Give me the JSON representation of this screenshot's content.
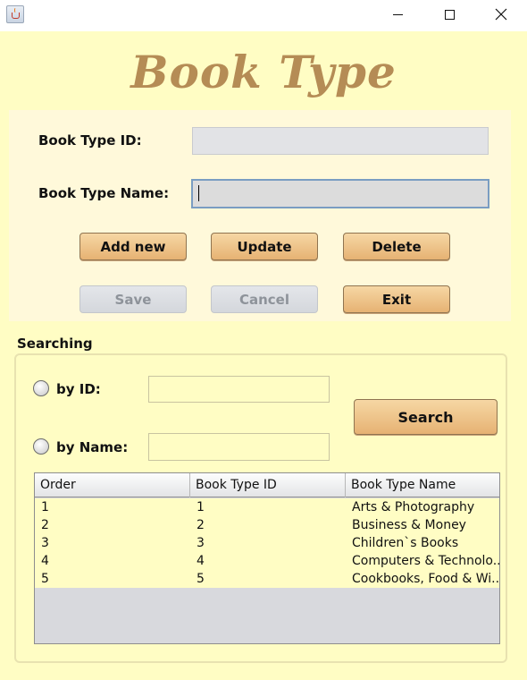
{
  "window": {
    "app_icon": "java-cup-icon"
  },
  "title": "Book Type",
  "form": {
    "id_label": "Book Type ID:",
    "id_value": "",
    "name_label": "Book Type Name:",
    "name_value": ""
  },
  "buttons": {
    "add_new": "Add new",
    "update": "Update",
    "delete": "Delete",
    "save": "Save",
    "cancel": "Cancel",
    "exit": "Exit"
  },
  "searching": {
    "label": "Searching",
    "by_id_label": "by ID:",
    "by_id_value": "",
    "by_name_label": "by Name:",
    "by_name_value": "",
    "search_button": "Search"
  },
  "table": {
    "columns": [
      "Order",
      "Book Type ID",
      "Book Type Name"
    ],
    "rows": [
      [
        "1",
        "1",
        "Arts & Photography"
      ],
      [
        "2",
        "2",
        "Business & Money"
      ],
      [
        "3",
        "3",
        "Children`s Books"
      ],
      [
        "4",
        "4",
        "Computers & Technolo..."
      ],
      [
        "5",
        "5",
        "Cookbooks, Food & Wi..."
      ]
    ]
  },
  "colors": {
    "background": "#fffdc4",
    "title": "#b58c55",
    "button": "#e6b273"
  }
}
